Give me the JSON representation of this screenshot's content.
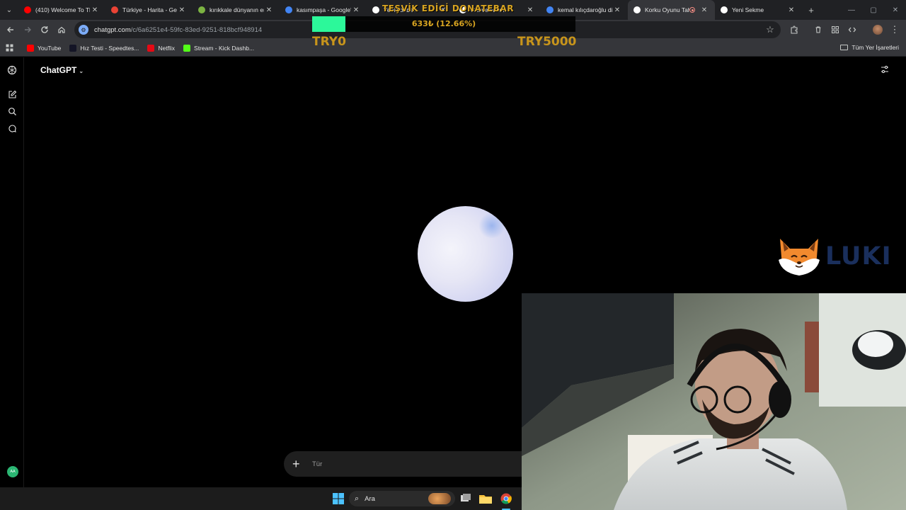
{
  "tabs": [
    {
      "title": "(410) Welcome To Th",
      "icon": "youtube-icon",
      "color": "#ff0000",
      "active": false
    },
    {
      "title": "Türkiye - Harita - Ge",
      "icon": "map-pin-icon",
      "color": "#ea4335",
      "active": false
    },
    {
      "title": "kırıkkale dünyanın en",
      "icon": "leaf-icon",
      "color": "#7cb342",
      "active": false
    },
    {
      "title": "kasımpaşa - Google'd",
      "icon": "google-icon",
      "color": "#4285f4",
      "active": false
    },
    {
      "title": "Yeni sohbet",
      "icon": "chatgpt-icon",
      "color": "#ffffff",
      "active": false
    },
    {
      "title": "Conversation",
      "icon": "chatgpt-icon",
      "color": "#ffffff",
      "active": false
    },
    {
      "title": "kemal kılıçdaroğlu di",
      "icon": "google-icon",
      "color": "#4285f4",
      "active": false
    },
    {
      "title": "Korku Oyunu Tah",
      "icon": "chatgpt-icon",
      "color": "#ffffff",
      "active": true
    },
    {
      "title": "Yeni Sekme",
      "icon": "chrome-icon",
      "color": "#ffffff",
      "active": false
    }
  ],
  "address": {
    "domain": "chatgpt.com",
    "path": "/c/6a6251e4-59fc-83ed-9251-818bcf948914"
  },
  "bookmarks": [
    {
      "label": "YouTube",
      "icon": "youtube-icon",
      "color": "#ff0000"
    },
    {
      "label": "Hız Testi - Speedtes...",
      "icon": "speedtest-icon",
      "color": "#141526"
    },
    {
      "label": "Netflix",
      "icon": "netflix-icon",
      "color": "#e50914"
    },
    {
      "label": "Stream - Kick Dashb...",
      "icon": "kick-icon",
      "color": "#53fc18"
    }
  ],
  "all_bookmarks_label": "Tüm Yer İşaretleri",
  "donation": {
    "title": "TEŞVİK EDİCİ DONATEBAR",
    "amount": "633₺ (12.66%)",
    "progress_percent": 12.66,
    "min_label": "TRY0",
    "max_label": "TRY5000"
  },
  "chatgpt": {
    "model_label": "ChatGPT",
    "composer_placeholder": "Tür",
    "user_initials": "AA"
  },
  "overlay_logo": {
    "text": "LUKI"
  },
  "taskbar": {
    "search_label": "Ara"
  },
  "colors": {
    "accent_green": "#2cf89a",
    "donate_gold": "#d9a521",
    "chrome_dark": "#202124",
    "chrome_toolbar": "#35363a"
  }
}
